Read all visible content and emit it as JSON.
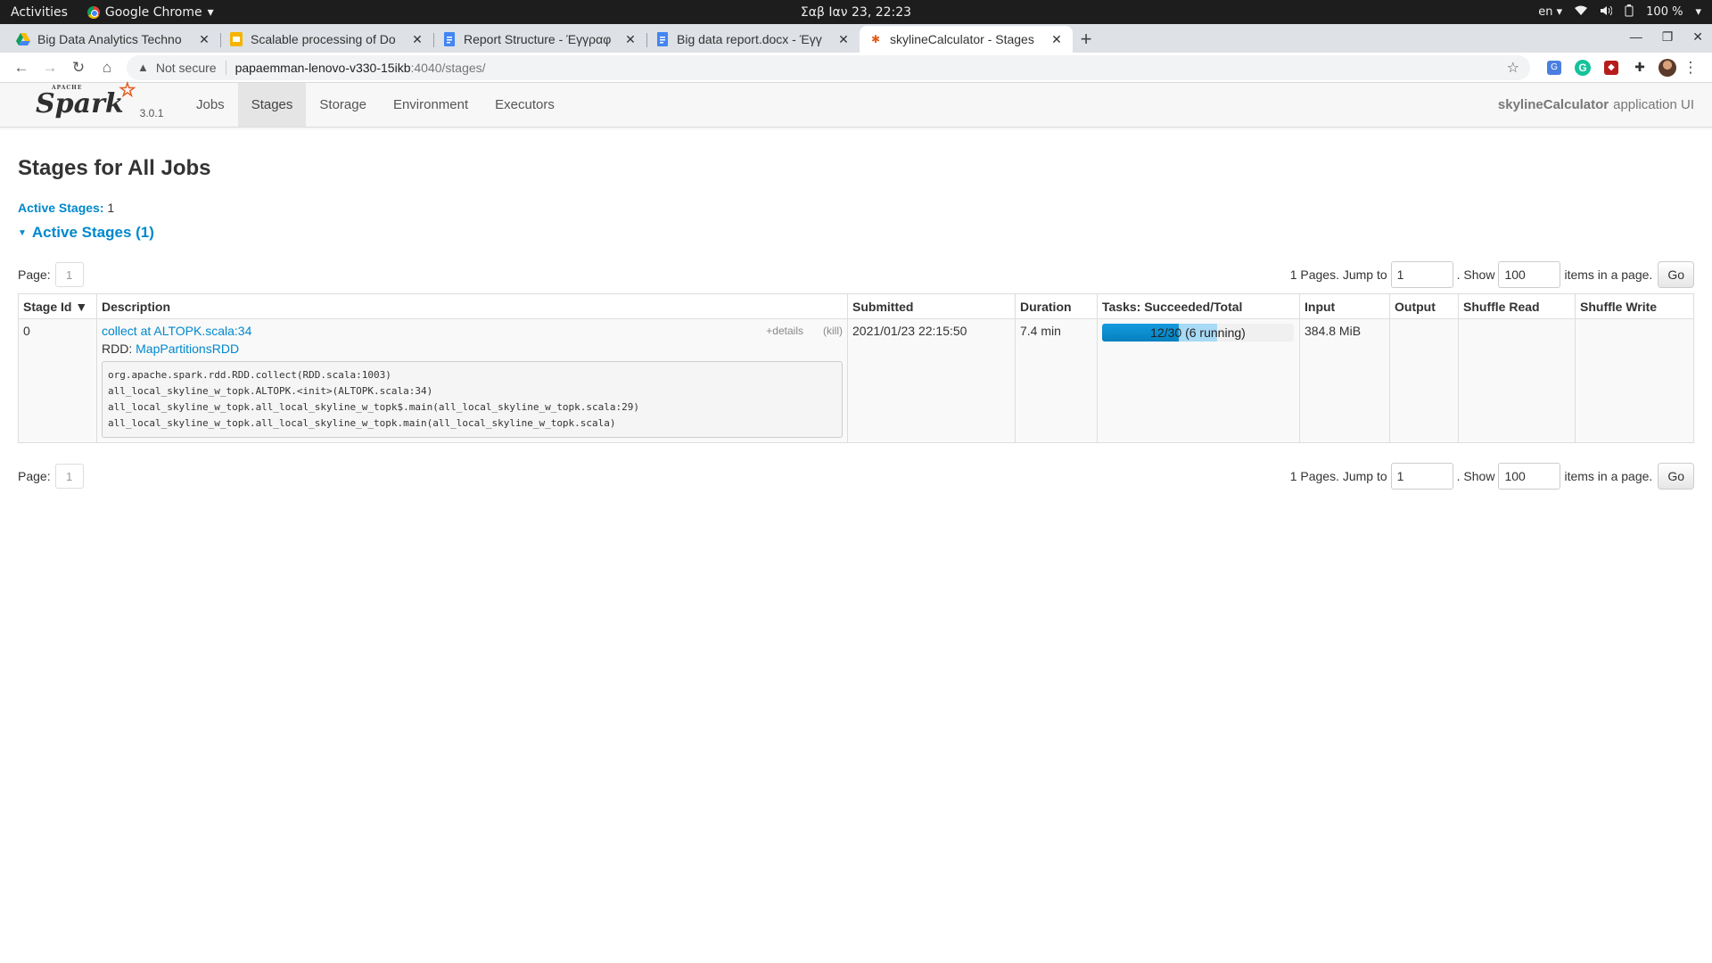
{
  "os": {
    "activities": "Activities",
    "app_name": "Google Chrome",
    "clock": "Σαβ Ιαν 23, 22:23",
    "lang": "en",
    "battery": "100 %"
  },
  "browser": {
    "tabs": [
      {
        "title": "Big Data Analytics Techno",
        "icon": "google-drive-icon"
      },
      {
        "title": "Scalable processing of Do",
        "icon": "slides-icon"
      },
      {
        "title": "Report Structure - Έγγραφ",
        "icon": "docs-icon"
      },
      {
        "title": "Big data report.docx - Έγγ",
        "icon": "docs-icon"
      },
      {
        "title": "skylineCalculator - Stages",
        "icon": "spark-icon"
      }
    ],
    "security": "Not secure",
    "url_host": "papaemman-lenovo-v330-15ikb",
    "url_path": ":4040/stages/"
  },
  "spark": {
    "version": "3.0.1",
    "nav": [
      "Jobs",
      "Stages",
      "Storage",
      "Environment",
      "Executors"
    ],
    "active_nav": "Stages",
    "app_name": "skylineCalculator",
    "app_suffix": "application UI"
  },
  "page": {
    "title": "Stages for All Jobs",
    "active_stages_label": "Active Stages:",
    "active_stages_count": "1",
    "section_title": "Active Stages (1)",
    "pager": {
      "page_label": "Page:",
      "current_page": "1",
      "pages_text": "1 Pages. Jump to",
      "jump_value": "1",
      "show_text": ". Show",
      "show_value": "100",
      "items_text": "items in a page.",
      "go": "Go"
    },
    "table": {
      "headers": [
        "Stage Id ▼",
        "Description",
        "Submitted",
        "Duration",
        "Tasks: Succeeded/Total",
        "Input",
        "Output",
        "Shuffle Read",
        "Shuffle Write"
      ],
      "rows": [
        {
          "stage_id": "0",
          "description_link": "collect at ALTOPK.scala:34",
          "details": "+details",
          "kill": "(kill)",
          "rdd_label": "RDD:",
          "rdd_link": "MapPartitionsRDD",
          "stacktrace": [
            "org.apache.spark.rdd.RDD.collect(RDD.scala:1003)",
            "all_local_skyline_w_topk.ALTOPK.<init>(ALTOPK.scala:34)",
            "all_local_skyline_w_topk.all_local_skyline_w_topk$.main(all_local_skyline_w_topk.scala:29)",
            "all_local_skyline_w_topk.all_local_skyline_w_topk.main(all_local_skyline_w_topk.scala)"
          ],
          "submitted": "2021/01/23 22:15:50",
          "duration": "7.4 min",
          "tasks_succeeded": 12,
          "tasks_running": 6,
          "tasks_total": 30,
          "tasks_label": "12/30 (6 running)",
          "input": "384.8 MiB",
          "output": "",
          "shuffle_read": "",
          "shuffle_write": ""
        }
      ]
    }
  },
  "colors": {
    "link": "#0088cc",
    "progress_done": "#0480be",
    "progress_running": "#a8daf5",
    "spark_star": "#e25a1c"
  }
}
